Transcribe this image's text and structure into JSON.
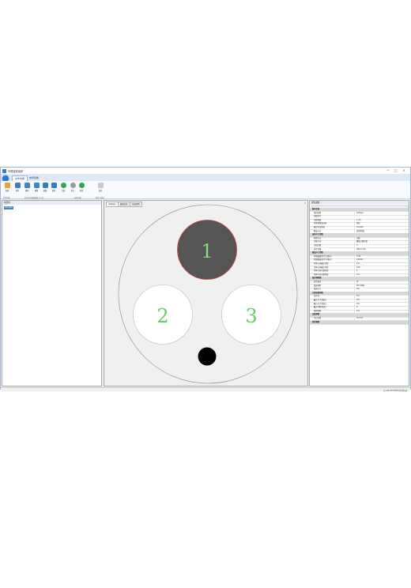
{
  "window": {
    "title": "外观选择窗体",
    "controls": [
      "—",
      "□",
      "×"
    ]
  },
  "ribbon": {
    "tabs": [
      {
        "label": "文件功能",
        "active": true
      },
      {
        "label": "布局功能",
        "active": false
      }
    ],
    "buttons": [
      {
        "label": "新建",
        "icon": "folder-open-icon",
        "color": "#e8a12a"
      },
      {
        "label": "保存",
        "icon": "save-icon",
        "color": "#3b7dc9"
      },
      {
        "label": "撤销",
        "icon": "undo-icon",
        "color": "#3f86c8"
      },
      {
        "label": "重做",
        "icon": "redo-icon",
        "color": "#3f86c8"
      },
      {
        "label": "编辑",
        "icon": "edit-icon",
        "color": "#2d7fcc"
      },
      {
        "label": "属性",
        "icon": "properties-icon",
        "color": "#2d7fcc"
      },
      {
        "label": "开始",
        "icon": "play-icon",
        "color": "#2fa84f"
      },
      {
        "label": "停止",
        "icon": "stop-icon",
        "color": "#9b9b9b"
      },
      {
        "label": "检查",
        "icon": "check-icon",
        "color": "#2fa84f"
      },
      {
        "label": "锁定",
        "icon": "lock-icon",
        "color": "#c8c8c8"
      }
    ],
    "groups": [
      "文件功能",
      "显示样式及视图显示方式",
      "布局功能",
      "检查与锁定"
    ]
  },
  "left_panel": {
    "header": "项目树",
    "items": [
      "Sample"
    ]
  },
  "doc_tabs": [
    {
      "label": "外观布局",
      "active": true
    },
    {
      "label": "截面信息",
      "active": false
    },
    {
      "label": "布局说明",
      "active": false
    }
  ],
  "canvas": {
    "cables": [
      {
        "label": "1",
        "fill": "#555555",
        "stroke": "#d04040",
        "text_color": "#88dd88"
      },
      {
        "label": "2",
        "fill": "#ffffff",
        "stroke": "#bbbbbb",
        "text_color": "#66cc66"
      },
      {
        "label": "3",
        "fill": "#ffffff",
        "stroke": "#bbbbbb",
        "text_color": "#66cc66"
      }
    ],
    "filler_fill": "#000000",
    "sheath_stroke": "#888888"
  },
  "right_panel": {
    "header": "属性面板",
    "rows": [
      {
        "type": "cat",
        "k": "基本信息",
        "v": ""
      },
      {
        "type": "row",
        "k": "项目名称",
        "v": "Sample"
      },
      {
        "type": "row",
        "k": "电缆型号",
        "v": ""
      },
      {
        "type": "row",
        "k": "芯数规格",
        "v": "1     (3)"
      },
      {
        "type": "row",
        "k": "导体材料及标准",
        "v": "铜芯"
      },
      {
        "type": "row",
        "k": "额定电压等级",
        "v": "0.6/1kV"
      },
      {
        "type": "row",
        "k": "敷设方式",
        "v": "直埋/排管"
      },
      {
        "type": "cat",
        "k": "结构尺寸参数",
        "v": ""
      },
      {
        "type": "row",
        "k": "绝缘方式",
        "v": "交联"
      },
      {
        "type": "row",
        "k": "护套方式",
        "v": "聚氯乙烯护套"
      },
      {
        "type": "row",
        "k": "分相芯数",
        "v": "3"
      },
      {
        "type": "row",
        "k": "外径范围",
        "v": "200.0  130"
      },
      {
        "type": "cat",
        "k": "截面尺寸参数",
        "v": ""
      },
      {
        "type": "row",
        "k": "导体截面积(平方毫米)",
        "v": "3.45"
      },
      {
        "type": "row",
        "k": "绝缘截面积(平方毫米)",
        "v": "100.00"
      },
      {
        "type": "row",
        "k": "导体之间最小间距",
        "v": "1.8"
      },
      {
        "type": "row",
        "k": "导体之间最大间距",
        "v": "100"
      },
      {
        "type": "row",
        "k": "导体与外护套间距",
        "v": "1"
      },
      {
        "type": "row",
        "k": "绝缘与外护套间距",
        "v": "1.0"
      },
      {
        "type": "cat",
        "k": "填充物参数",
        "v": ""
      },
      {
        "type": "row",
        "k": "是否填充",
        "v": "否"
      },
      {
        "type": "row",
        "k": "填充材料",
        "v": "PVC 塑料"
      },
      {
        "type": "row",
        "k": "填充尺寸",
        "v": "5.6"
      },
      {
        "type": "cat",
        "k": "计算结果参数",
        "v": ""
      },
      {
        "type": "row",
        "k": "总外径",
        "v": "0.0"
      },
      {
        "type": "row",
        "k": "最大尺寸(毫米)",
        "v": "0.0"
      },
      {
        "type": "row",
        "k": "最小尺寸(毫米)",
        "v": "0.0"
      },
      {
        "type": "row",
        "k": "最大间隙(毫米)",
        "v": "0"
      },
      {
        "type": "row",
        "k": "结构参数",
        "v": "0.0"
      },
      {
        "type": "cat",
        "k": "位置参数",
        "v": ""
      },
      {
        "type": "row",
        "k": "中心位置",
        "v": "0.0 0.0"
      },
      {
        "type": "cat",
        "k": "其他参数",
        "v": ""
      }
    ]
  },
  "status": {
    "text": "长 (26.9771656)    外径信息"
  }
}
